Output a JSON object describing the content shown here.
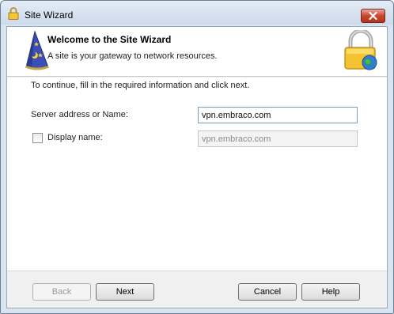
{
  "window": {
    "title": "Site Wizard",
    "title_icon": "padlock-icon",
    "close_icon": "close-icon"
  },
  "header": {
    "title": "Welcome to the Site Wizard",
    "subtitle": "A site is your gateway to network resources.",
    "left_icon": "wizard-hat-icon",
    "right_icon": "padlock-globe-icon"
  },
  "form": {
    "instruction": "To continue, fill in the required information and click next.",
    "server_label": "Server address or Name:",
    "server_value": "vpn.embraco.com",
    "display_checkbox_checked": false,
    "display_label": "Display name:",
    "display_value": "vpn.embraco.com"
  },
  "buttons": {
    "back": "Back",
    "next": "Next",
    "cancel": "Cancel",
    "help": "Help"
  },
  "colors": {
    "titlebar": "#d9e4f1",
    "close_button": "#c9462f",
    "dialog_background": "#f0f0f0",
    "disabled_text": "#9a9a9a"
  }
}
